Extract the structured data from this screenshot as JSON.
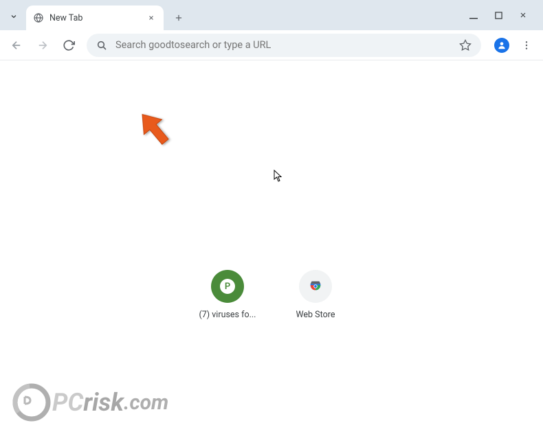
{
  "titlebar": {
    "tab_title": "New Tab"
  },
  "toolbar": {
    "omnibox_placeholder": "Search goodtosearch or type a URL"
  },
  "shortcuts": [
    {
      "label": "(7) viruses fo...",
      "badge": "P",
      "icon_style": "green"
    },
    {
      "label": "Web Store",
      "icon_style": "webstore"
    }
  ],
  "watermark": {
    "part1": "PC",
    "part2": "risk",
    "part3": ".com"
  }
}
